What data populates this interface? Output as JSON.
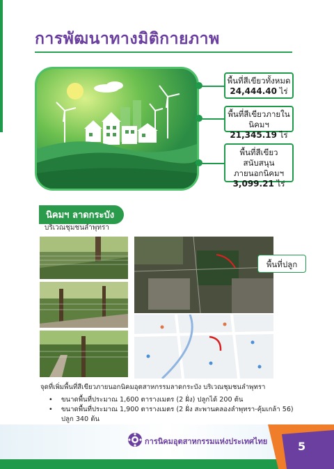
{
  "title": "การพัฒนาทางมิติกายภาพ",
  "stats": [
    {
      "label": "พื้นที่สีเขียวทั้งหมด",
      "value": "24,444.40",
      "unit": "ไร่"
    },
    {
      "label": "พื้นที่สีเขียวภายในนิคมฯ",
      "value": "21,345.19",
      "unit": "ไร่"
    },
    {
      "label_line1": "พื้นที่สีเขียวสนับสนุน",
      "label_line2": "ภายนอกนิคมฯ",
      "value": "3,099.21",
      "unit": "ไร่"
    }
  ],
  "section": {
    "tag": "นิคมฯ ลาดกระบัง",
    "subtitle": "บริเวณชุมชนลำพุทรา"
  },
  "map_label": "พื้นที่ปลูก",
  "description": "จุดที่เพิ่มพื้นที่สีเขียวภายนอกนิคมอุตสาหกรรมลาดกระบัง บริเวณชุมชนลำพุทรา",
  "bullets": [
    {
      "line1": "ขนาดพื้นที่ประมาณ 1,600 ตารางเมตร (2 ฝั่ง) ปลูกได้ 200 ต้น",
      "line2": ""
    },
    {
      "line1": "ขนาดพื้นที่ประมาณ 1,900 ตารางเมตร (2 ฝั่ง สะพานคลองลำพุทรา-คุ้มเกล้า 56)",
      "line2": "ปลูก 340 ต้น"
    }
  ],
  "footer": {
    "org_name": "การนิคมอุตสาหกรรมแห่งประเทศไทย",
    "page_number": "5"
  },
  "colors": {
    "brand_green": "#1f9a4a",
    "brand_purple": "#6b3fa0",
    "accent_orange": "#f07d2a"
  }
}
